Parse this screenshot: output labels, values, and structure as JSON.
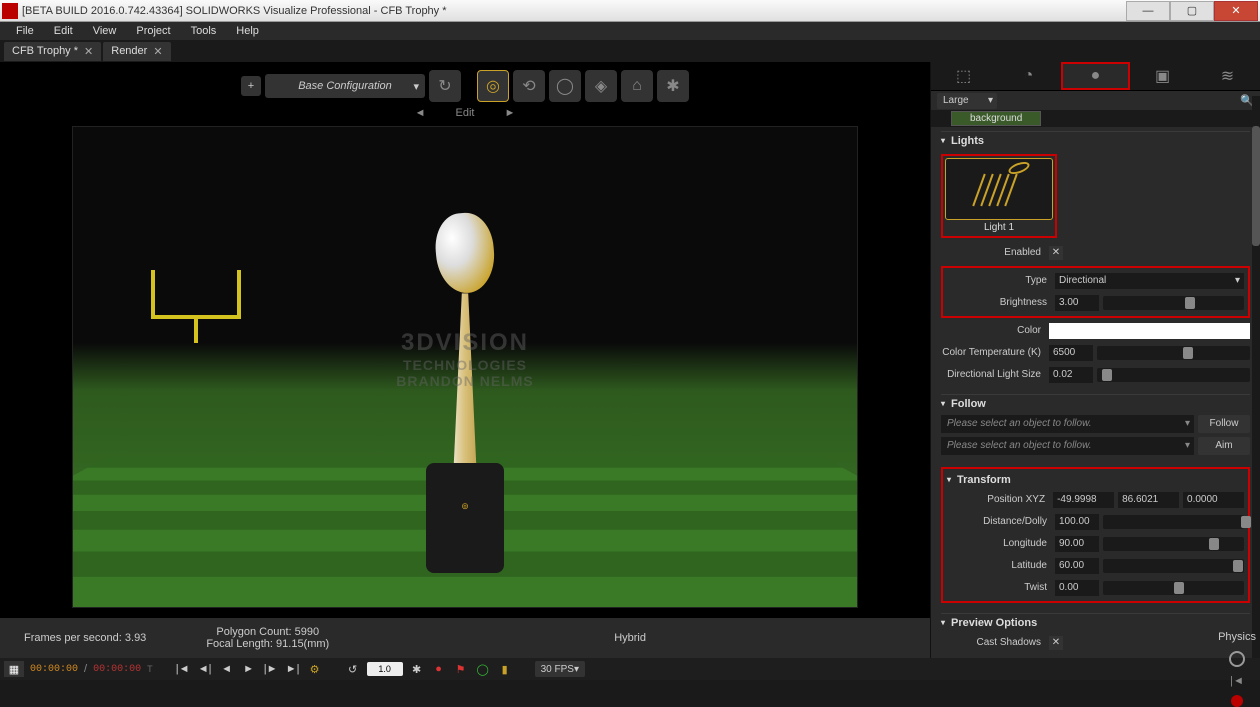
{
  "titlebar": {
    "title": "[BETA BUILD 2016.0.742.43364] SOLIDWORKS Visualize Professional - CFB Trophy *"
  },
  "menubar": [
    "File",
    "Edit",
    "View",
    "Project",
    "Tools",
    "Help"
  ],
  "tabs": [
    {
      "label": "CFB Trophy *"
    },
    {
      "label": "Render"
    }
  ],
  "viewportToolbar": {
    "config": "Base Configuration",
    "editrow": {
      "prev": "◄",
      "label": "Edit",
      "next": "►"
    }
  },
  "watermark": {
    "line1": "3DVISION",
    "line2": "TECHNOLOGIES",
    "line3": "BRANDON NELMS"
  },
  "status": {
    "fps_label": "Frames per second:",
    "fps_value": "3.93",
    "polycount_label": "Polygon Count:",
    "polycount_value": "5990",
    "focal_label": "Focal Length:",
    "focal_value": "91.15(mm)",
    "renderer": "Hybrid"
  },
  "timeline": {
    "t1": "00:00:00",
    "t2": "00:00:00",
    "tsuffix": "T",
    "speed": "1.0",
    "fps": "30 FPS",
    "physics": "Physics"
  },
  "rightPanel": {
    "sizeFilter": "Large",
    "background": "background",
    "sections": {
      "lights": "Lights",
      "follow": "Follow",
      "transform": "Transform",
      "preview": "Preview Options"
    },
    "light": {
      "name": "Light 1"
    },
    "props": {
      "enabled": {
        "label": "Enabled",
        "checked": "✕"
      },
      "type": {
        "label": "Type",
        "value": "Directional"
      },
      "brightness": {
        "label": "Brightness",
        "value": "3.00",
        "sliderPct": 58
      },
      "color": {
        "label": "Color",
        "hex": "#ffffff"
      },
      "colortemp": {
        "label": "Color Temperature (K)",
        "value": "6500",
        "sliderPct": 56
      },
      "dirsize": {
        "label": "Directional Light Size",
        "value": "0.02",
        "sliderPct": 3
      }
    },
    "follow": {
      "placeholder": "Please select an object to follow.",
      "followBtn": "Follow",
      "aimBtn": "Aim"
    },
    "transform": {
      "posLabel": "Position XYZ",
      "x": "-49.9998",
      "y": "86.6021",
      "z": "0.0000",
      "dist": {
        "label": "Distance/Dolly",
        "value": "100.00",
        "sliderPct": 98
      },
      "lon": {
        "label": "Longitude",
        "value": "90.00",
        "sliderPct": 75
      },
      "lat": {
        "label": "Latitude",
        "value": "60.00",
        "sliderPct": 92
      },
      "twist": {
        "label": "Twist",
        "value": "0.00",
        "sliderPct": 50
      }
    },
    "preview": {
      "castShadows": {
        "label": "Cast Shadows",
        "checked": "✕"
      }
    }
  }
}
